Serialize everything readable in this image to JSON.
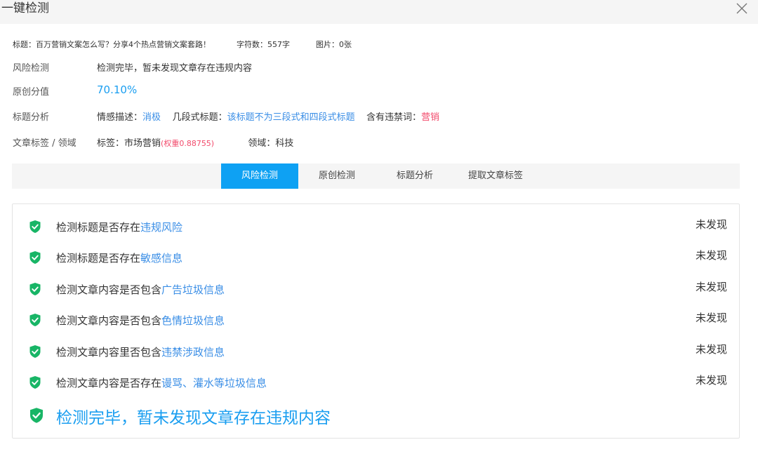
{
  "window": {
    "title": "一键检测",
    "close_icon": "close-icon"
  },
  "meta": {
    "title_label": "标题：",
    "title_value": "百万营销文案怎么写？分享4个热点营销文案套路！",
    "chars_label": "字符数：",
    "chars_value": "557字",
    "images_label": "图片：",
    "images_value": "0张"
  },
  "risk": {
    "label": "风险检测",
    "value": "检测完毕，暂未发现文章存在违规内容"
  },
  "original": {
    "label": "原创分值",
    "value": "70.10%"
  },
  "title_analysis": {
    "label": "标题分析",
    "emotion_label": "情感描述：",
    "emotion_value": "消极",
    "segment_label": "几段式标题：",
    "segment_value": "该标题不为三段式和四段式标题",
    "banned_label": "含有违禁词：",
    "banned_value": "营销"
  },
  "tags": {
    "label": "文章标签 / 领域",
    "tag_label": "标签：",
    "tag_value": "市场营销",
    "weight_value": "(权重0.88755)",
    "domain_label": "领域：",
    "domain_value": "科技"
  },
  "tabs": [
    {
      "label": "风险检测",
      "active": true
    },
    {
      "label": "原创检测",
      "active": false
    },
    {
      "label": "标题分析",
      "active": false
    },
    {
      "label": "提取文章标签",
      "active": false
    }
  ],
  "checks": [
    {
      "prefix": "检测标题是否存在",
      "highlight": "违规风险",
      "status": "未发现"
    },
    {
      "prefix": "检测标题是否存在",
      "highlight": "敏感信息",
      "status": "未发现"
    },
    {
      "prefix": "检测文章内容是否包含",
      "highlight": "广告垃圾信息",
      "status": "未发现"
    },
    {
      "prefix": "检测文章内容是否包含",
      "highlight": "色情垃圾信息",
      "status": "未发现"
    },
    {
      "prefix": "检测文章内容里否包含",
      "highlight": "违禁涉政信息",
      "status": "未发现"
    },
    {
      "prefix": "检测文章内容是否存在",
      "highlight": "谩骂、灌水等垃圾信息",
      "status": "未发现"
    }
  ],
  "final_message": "检测完毕，暂未发现文章存在违规内容",
  "colors": {
    "accent": "#0ea1f3",
    "link": "#3a8ee6",
    "danger": "#f24a6b",
    "shield": "#18b566"
  },
  "icons": {
    "check": "shield-check-icon"
  }
}
